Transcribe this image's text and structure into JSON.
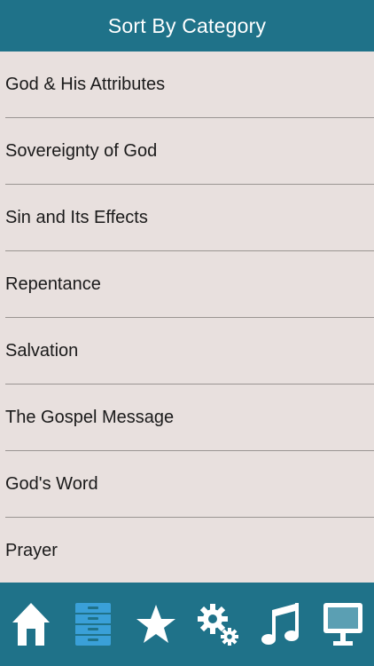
{
  "header": {
    "title": "Sort By Category"
  },
  "categories": [
    "God & His Attributes",
    "Sovereignty of God",
    "Sin and Its Effects",
    "Repentance",
    "Salvation",
    "The Gospel Message",
    "God's Word",
    "Prayer"
  ],
  "tabbar": {
    "active_tab": "categories",
    "tabs": [
      {
        "icon": "home-icon"
      },
      {
        "icon": "filing-cabinet-icon"
      },
      {
        "icon": "star-icon"
      },
      {
        "icon": "gears-icon"
      },
      {
        "icon": "music-note-icon"
      },
      {
        "icon": "presentation-screen-icon"
      }
    ]
  },
  "colors": {
    "bar": "#1f7289",
    "list_background": "#e8e0de",
    "active_icon": "#3aa0d8",
    "icon": "#ffffff"
  }
}
